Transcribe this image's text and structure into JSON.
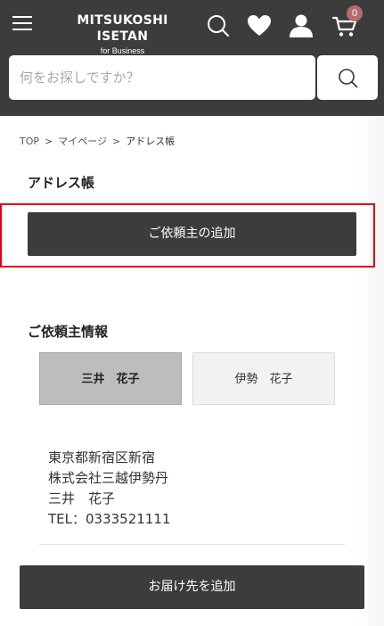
{
  "header": {
    "logo_main": "MITSUKOSHI ISETAN",
    "logo_sub": "for Business",
    "cart_count": "0"
  },
  "search": {
    "placeholder": "何をお探しですか？"
  },
  "breadcrumb": {
    "items": [
      "TOP",
      "マイページ",
      "アドレス帳"
    ],
    "separator": ">"
  },
  "page": {
    "title": "アドレス帳",
    "add_client_label": "ご依頼主の追加"
  },
  "client_section": {
    "title": "ご依頼主情報",
    "tabs": [
      {
        "label": "三井　花子",
        "active": true
      },
      {
        "label": "伊勢　花子",
        "active": false
      }
    ]
  },
  "address": {
    "line1": "東京都新宿区新宿",
    "line2": "株式会社三越伊勢丹",
    "line3": "三井　花子",
    "line4": "TEL：0333521111"
  },
  "actions": {
    "add_delivery_label": "お届け先を追加"
  },
  "colors": {
    "header_bg": "#3c3c3c",
    "button_bg": "#3c3c3c",
    "highlight_border": "#e60012",
    "cart_badge": "#b56b6f"
  },
  "icons": [
    "menu-icon",
    "search-icon",
    "heart-icon",
    "user-icon",
    "cart-icon"
  ]
}
